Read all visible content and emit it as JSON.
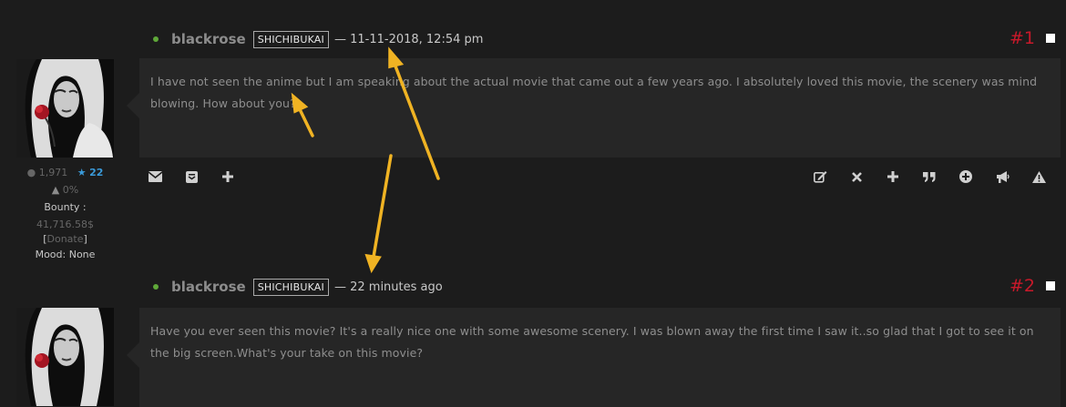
{
  "colors": {
    "accent": "#c8192a",
    "online": "#5fa839",
    "annotation_arrow": "#f0b323"
  },
  "posts": [
    {
      "username": "blackrose",
      "rank": "SHICHIBUKAI",
      "timestamp": "— 11-11-2018, 12:54 pm",
      "number": "#1",
      "message": "I have not seen the anime but I am speaking about the actual movie that came out a few years ago. I absolutely loved this movie, the scenery was mind blowing. How about you?",
      "stats": {
        "posts": "1,971",
        "reputation": "22",
        "warning": "0%",
        "bounty_label": "Bounty :",
        "bounty_value": "41,716.58$",
        "donate_open": "[",
        "donate": "Donate",
        "donate_close": "]",
        "mood": "Mood: None"
      },
      "actions_left": [
        "envelope-icon",
        "message-box-icon",
        "plus-icon"
      ],
      "actions_right": [
        "edit-icon",
        "delete-icon",
        "plus-icon",
        "quote-icon",
        "multi-quote-icon",
        "announce-icon",
        "report-icon"
      ]
    },
    {
      "username": "blackrose",
      "rank": "SHICHIBUKAI",
      "timestamp": "— 22 minutes ago",
      "number": "#2",
      "message": "Have you ever seen this movie? It's a really nice one with some awesome scenery. I was blown away the first time I saw it..so glad that I got to see it on the big screen.What's your take on this movie?"
    }
  ]
}
